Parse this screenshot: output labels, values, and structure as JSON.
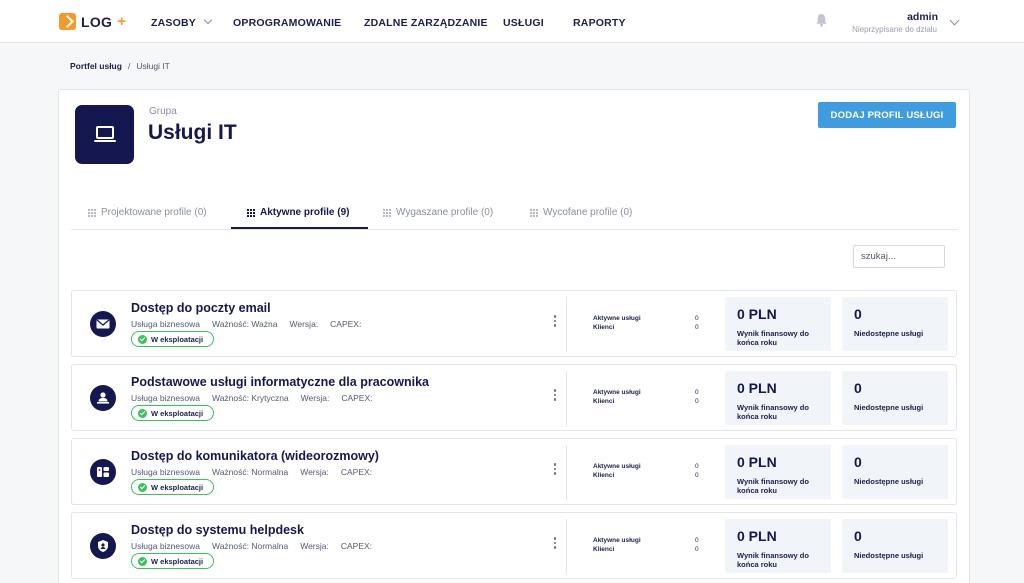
{
  "header": {
    "logo_text": "LOG",
    "logo_plus": "+",
    "nav": [
      "ZASOBY",
      "OPROGRAMOWANIE",
      "ZDALNE ZARZĄDZANIE",
      "USŁUGI",
      "RAPORTY"
    ],
    "user_name": "admin",
    "user_sub": "Nieprzypisane do działu"
  },
  "breadcrumb": {
    "root": "Portfel usług",
    "separator": "/",
    "current": "Usługi IT"
  },
  "group": {
    "label": "Grupa",
    "title": "Usługi IT"
  },
  "add_button": "DODAJ PROFIL USŁUGI",
  "tabs": [
    {
      "label": "Projektowane profile (0)"
    },
    {
      "label": "Aktywne profile (9)"
    },
    {
      "label": "Wygaszane profile (0)"
    },
    {
      "label": "Wycofane profile (0)"
    }
  ],
  "search": {
    "placeholder": "szukaj..."
  },
  "services": [
    {
      "title": "Dostęp do poczty email",
      "type": "Usługa biznesowa",
      "importance": "Ważność: Ważna",
      "version": "Wersja:",
      "capex": "CAPEX:",
      "status": "W eksploatacji",
      "active_label": "Aktywne usługi",
      "active_value": "0",
      "clients_label": "Klienci",
      "clients_value": "0",
      "financial_value": "0 PLN",
      "financial_label": "Wynik finansowy do końca roku",
      "unavailable_value": "0",
      "unavailable_label": "Niedostępne usługi",
      "icon": "envelope-icon"
    },
    {
      "title": "Podstawowe usługi informatyczne dla pracownika",
      "type": "Usługa biznesowa",
      "importance": "Ważność: Krytyczna",
      "version": "Wersja:",
      "capex": "CAPEX:",
      "status": "W eksploatacji",
      "active_label": "Aktywne usługi",
      "active_value": "0",
      "clients_label": "Klienci",
      "clients_value": "0",
      "financial_value": "0 PLN",
      "financial_label": "Wynik finansowy do końca roku",
      "unavailable_value": "0",
      "unavailable_label": "Niedostępne usługi",
      "icon": "user-desk-icon"
    },
    {
      "title": "Dostęp do komunikatora (wideorozmowy)",
      "type": "Usługa biznesowa",
      "importance": "Ważność: Normalna",
      "version": "Wersja:",
      "capex": "CAPEX:",
      "status": "W eksploatacji",
      "active_label": "Aktywne usługi",
      "active_value": "0",
      "clients_label": "Klienci",
      "clients_value": "0",
      "financial_value": "0 PLN",
      "financial_label": "Wynik finansowy do końca roku",
      "unavailable_value": "0",
      "unavailable_label": "Niedostępne usługi",
      "icon": "video-chat-icon"
    },
    {
      "title": "Dostęp do systemu helpdesk",
      "type": "Usługa biznesowa",
      "importance": "Ważność: Normalna",
      "version": "Wersja:",
      "capex": "CAPEX:",
      "status": "W eksploatacji",
      "active_label": "Aktywne usługi",
      "active_value": "0",
      "clients_label": "Klienci",
      "clients_value": "0",
      "financial_value": "0 PLN",
      "financial_label": "Wynik finansowy do końca roku",
      "unavailable_value": "0",
      "unavailable_label": "Niedostępne usługi",
      "icon": "helpdesk-icon"
    }
  ],
  "colors": {
    "navy": "#151850",
    "accent": "#3f9cde",
    "brand": "#f39a2d",
    "status_green": "#3fbf5d"
  }
}
